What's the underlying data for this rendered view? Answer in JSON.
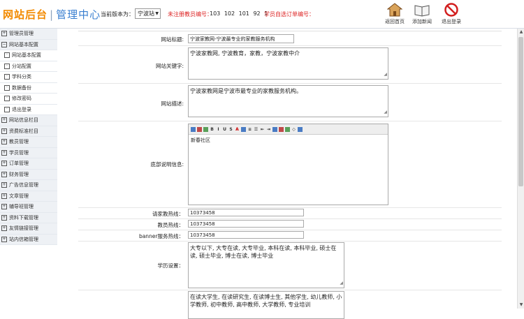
{
  "header": {
    "logo_main": "网站后台",
    "logo_sub": "管理中心",
    "version_label": "当前版本为：",
    "version_value": "宁波站",
    "teacher_no_label": "未注册教员编号：",
    "teacher_nos": "103  102  101  92  1",
    "order_no_label": "学员自选订单编号：",
    "buttons": [
      {
        "label": "返回首页",
        "icon": "home-icon"
      },
      {
        "label": "添加新闻",
        "icon": "book-icon"
      },
      {
        "label": "退出登录",
        "icon": "no-entry-icon"
      }
    ]
  },
  "sidebar": {
    "items": [
      {
        "label": "管理员管理",
        "type": "top"
      },
      {
        "label": "网站基本配置",
        "type": "top"
      },
      {
        "label": "网站基本配置",
        "type": "sub"
      },
      {
        "label": "分站配置",
        "type": "sub"
      },
      {
        "label": "学科分类",
        "type": "sub"
      },
      {
        "label": "数据备份",
        "type": "sub"
      },
      {
        "label": "修改密码",
        "type": "sub"
      },
      {
        "label": "退出登录",
        "type": "sub"
      },
      {
        "label": "网站信息栏目",
        "type": "top"
      },
      {
        "label": "资费标准栏目",
        "type": "top"
      },
      {
        "label": "教员管理",
        "type": "top"
      },
      {
        "label": "学员管理",
        "type": "top"
      },
      {
        "label": "订单管理",
        "type": "top"
      },
      {
        "label": "财务管理",
        "type": "top"
      },
      {
        "label": "广告信息管理",
        "type": "top"
      },
      {
        "label": "文章管理",
        "type": "top"
      },
      {
        "label": "辅导班管理",
        "type": "top"
      },
      {
        "label": "资料下载管理",
        "type": "top"
      },
      {
        "label": "友情链接管理",
        "type": "top"
      },
      {
        "label": "站内信箱管理",
        "type": "top"
      }
    ]
  },
  "form": {
    "site_title_label": "网站标题:",
    "site_title_value": "宁波家教网-宁波最专业的家教服务机构",
    "keywords_label": "网站关键字:",
    "keywords_value": "宁波家教网, 宁波教育，家教，宁波家教中介",
    "description_label": "网站描述:",
    "description_value": "宁波家教网是宁波市最专业的家教服务机构。",
    "footer_label": "底部说明信息:",
    "footer_content": "新春社区",
    "hotline_label": "请家教热线：",
    "hotline_value": "10373458",
    "teacher_hotline_label": "教员热线：",
    "teacher_hotline_value": "10373458",
    "banner_hotline_label": "banner服务热线：",
    "banner_hotline_value": "10373458",
    "education_label": "学历设置：",
    "education_value": "大专以下, 大专在读, 大专毕业, 本科在读, 本科毕业, 硕士在读, 硕士毕业, 博士在读, 博士毕业",
    "identity_value": "在读大学生, 在读研究生, 在读博士生, 其他学生, 幼儿教师, 小学教师, 初中教师, 高中教师, 大学教师, 专业培训"
  },
  "colors": {
    "logo_orange": "#f28a00",
    "logo_blue": "#3a7fd0",
    "alert_red": "#dd2222"
  }
}
